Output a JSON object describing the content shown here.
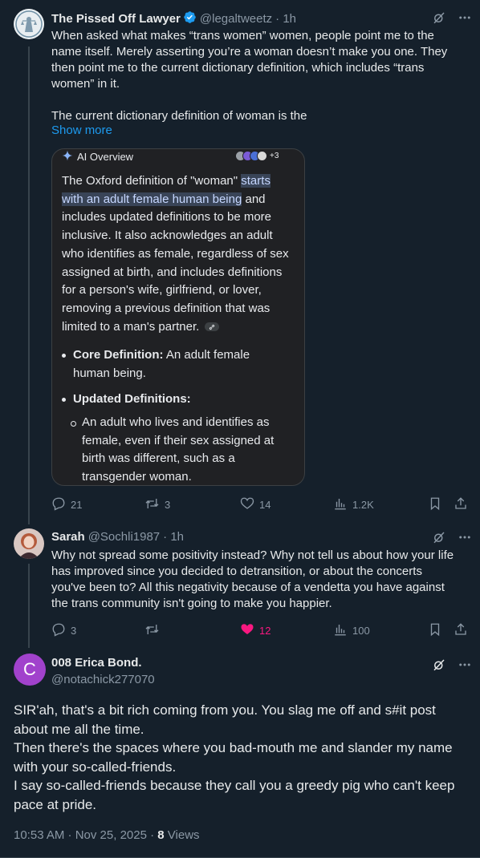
{
  "tweet1": {
    "name": "The Pissed Off Lawyer",
    "handle": "@legaltweetz",
    "time": "· 1h",
    "text_lines": [
      "When asked what makes “trans women” women, people point me to the",
      "name itself. Merely asserting you’re a woman doesn’t make you one. They",
      "then point me to the current dictionary definition, which includes “trans",
      "women” in it.",
      "",
      "The current dictionary definition of woman is the"
    ],
    "show_more": "Show more",
    "card": {
      "title": "AI Overview",
      "source_count": "+3",
      "para_before": "The Oxford definition of \"woman\" ",
      "para_highlight": "starts with an adult female human being",
      "para_after": " and includes updated definitions to be more inclusive. It also acknowledges an adult who identifies as female, regardless of sex assigned at birth, and includes definitions for a person's wife, girlfriend, or lover, removing a previous definition that was limited to a man's partner.",
      "bullet1_label": "Core Definition:",
      "bullet1_text": " An adult female human being.",
      "bullet2_label": "Updated Definitions:",
      "sub_bullet": "An adult who lives and identifies as female, even if their sex assigned at birth was different, such as a transgender woman."
    },
    "stats": {
      "replies": "21",
      "reposts": "3",
      "likes": "14",
      "views": "1.2K"
    }
  },
  "tweet2": {
    "name": "Sarah",
    "handle": "@Sochli1987",
    "time": "· 1h",
    "text_lines": [
      "Why not spread some positivity instead? Why not tell us about how your life",
      "has improved since you decided to detransition, or about the concerts",
      "you've been to? All this negativity because of a vendetta you have against",
      "the trans community isn't going to make you happier."
    ],
    "stats": {
      "replies": "3",
      "reposts": "",
      "likes": "12",
      "views": "100"
    }
  },
  "main": {
    "avatar_letter": "C",
    "name": "008 Erica Bond.",
    "handle": "@notachick277070",
    "text_lines": [
      "SIR'ah, that's a bit rich coming from you. You slag me off and s#it post",
      "about me all the time.",
      "Then there's the spaces where you bad-mouth me and slander my name",
      "with your so-called-friends.",
      "I say so-called-friends because they call you a greedy pig who can't keep",
      "pace at pride."
    ],
    "timestamp": "10:53 AM · Nov 25, 2025 · ",
    "views_count": "8",
    "views_label": " Views"
  },
  "colors": {
    "background": "#15202b",
    "text": "#e7e9ea",
    "muted": "#8b98a5",
    "accent": "#1d9bf0",
    "like_active": "#f91880",
    "avatar_purple": "#a142cc"
  },
  "icons": [
    "verified-badge-icon",
    "grok-icon",
    "more-icon",
    "reply-icon",
    "repost-icon",
    "like-icon",
    "views-icon",
    "bookmark-icon",
    "share-icon",
    "sparkle-icon",
    "link-icon"
  ]
}
